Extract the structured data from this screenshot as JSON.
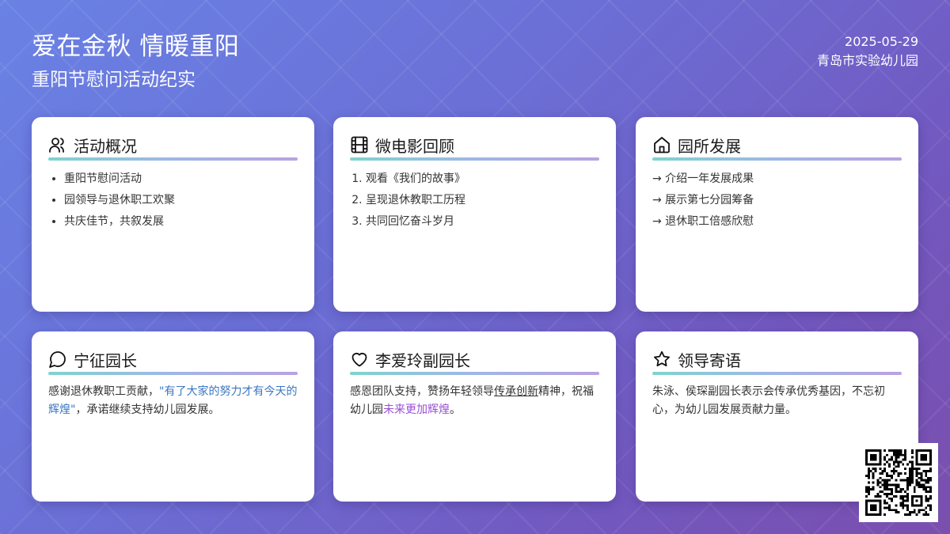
{
  "header": {
    "title": "爱在金秋 情暖重阳",
    "subtitle": "重阳节慰问活动纪实",
    "date": "2025-05-29",
    "org": "青岛市实验幼儿园"
  },
  "cards": [
    {
      "title": "活动概况",
      "icon": "users-icon",
      "items": [
        "重阳节慰问活动",
        "园领导与退休职工欢聚",
        "共庆佳节，共叙发展"
      ]
    },
    {
      "title": "微电影回顾",
      "icon": "film-icon",
      "items": [
        "观看《我们的故事》",
        "呈现退休教职工历程",
        "共同回忆奋斗岁月"
      ]
    },
    {
      "title": "园所发展",
      "icon": "home-icon",
      "items": [
        "→ 介绍一年发展成果",
        "→ 展示第七分园筹备",
        "→ 退休职工倍感欣慰"
      ]
    },
    {
      "title": "宁征园长",
      "icon": "message-icon",
      "text_before": "感谢退休教职工贡献，",
      "quote": "\"有了大家的努力才有今天的辉煌\"",
      "text_after": "，承诺继续支持幼儿园发展。"
    },
    {
      "title": "李爱玲副园长",
      "icon": "heart-icon",
      "text_before": "感恩团队支持，赞扬年轻领导",
      "underline": "传承创新",
      "text_mid": "精神，祝福幼儿园",
      "highlight": "未来更加辉煌",
      "text_after": "。"
    },
    {
      "title": "领导寄语",
      "icon": "star-icon",
      "text": "朱泳、侯琛副园长表示会传承优秀基因，不忘初心，为幼儿园发展贡献力量。"
    }
  ],
  "colors": {
    "accent_blue": "#3a76c2",
    "accent_purple": "#9a4fd4",
    "bar_start": "#7fd3cf",
    "bar_end": "#b9a2e2"
  }
}
